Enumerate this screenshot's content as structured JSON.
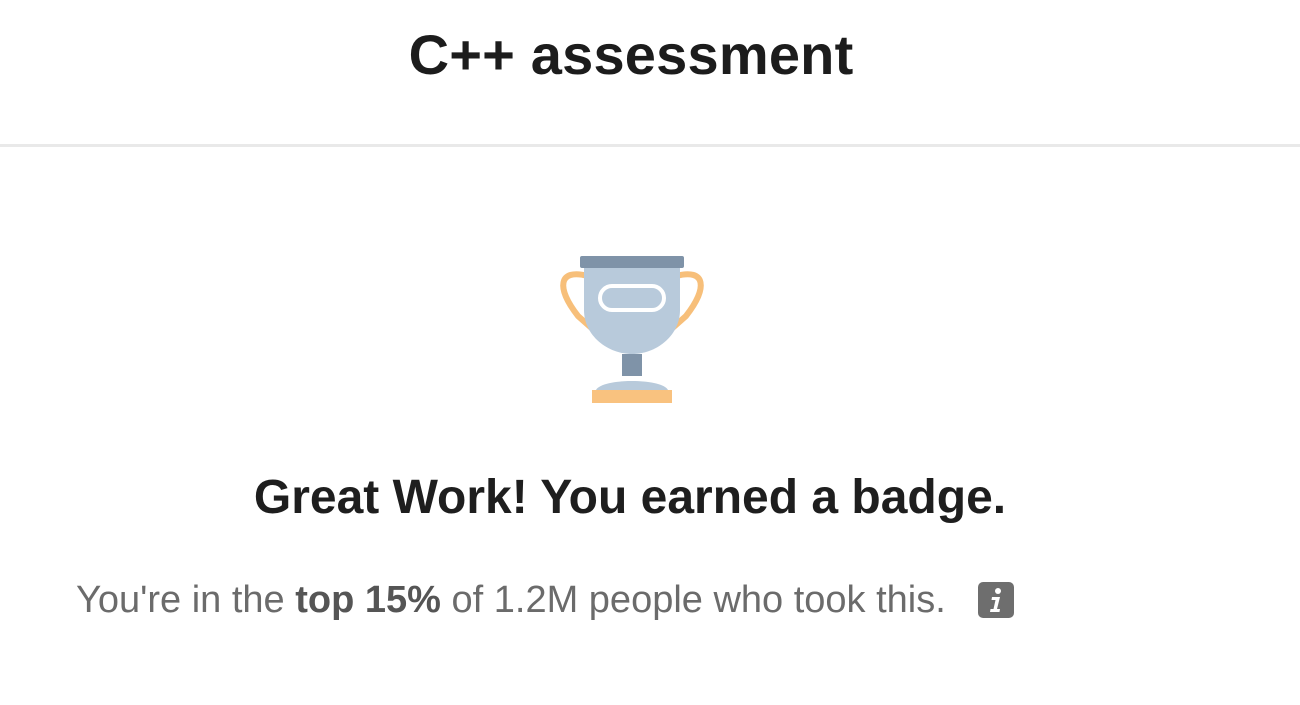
{
  "header": {
    "title": "C++ assessment"
  },
  "result": {
    "badge_icon": "trophy-icon",
    "headline": "Great Work! You earned a badge.",
    "summary_prefix": "You're in the ",
    "summary_highlight": "top 15%",
    "summary_suffix": " of 1.2M people who took this.",
    "info_icon": "info-icon"
  },
  "colors": {
    "trophy_cup": "#b8cadb",
    "trophy_rim": "#7f93a8",
    "trophy_handles": "#f7bf7a",
    "trophy_base": "#f9c27f",
    "info_icon_bg": "#6e6e6e"
  }
}
